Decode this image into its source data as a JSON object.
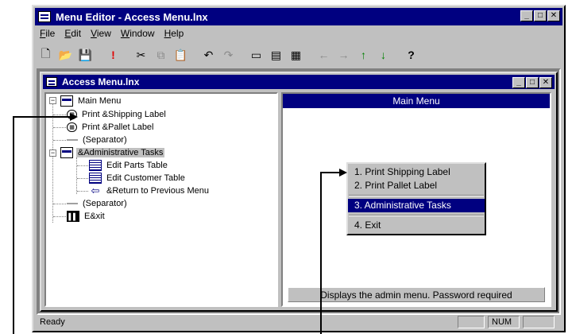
{
  "window": {
    "title": "Menu Editor - Access Menu.lnx",
    "controls": [
      "_",
      "□",
      "✕"
    ]
  },
  "menubar": [
    "File",
    "Edit",
    "View",
    "Window",
    "Help"
  ],
  "toolbar": {
    "buttons": [
      {
        "name": "new-icon",
        "glyph": "🗋"
      },
      {
        "name": "open-icon",
        "glyph": "📂"
      },
      {
        "name": "save-icon",
        "glyph": "💾"
      },
      {
        "name": "run-icon",
        "glyph": "!"
      },
      {
        "name": "cut-icon",
        "glyph": "✂"
      },
      {
        "name": "copy-icon",
        "glyph": "⧉"
      },
      {
        "name": "paste-icon",
        "glyph": "📋"
      },
      {
        "name": "undo-icon",
        "glyph": "↶"
      },
      {
        "name": "redo-icon",
        "glyph": "↷"
      },
      {
        "name": "insert-item-icon",
        "glyph": "▭"
      },
      {
        "name": "insert-submenu-icon",
        "glyph": "▤"
      },
      {
        "name": "properties-icon",
        "glyph": "▦"
      },
      {
        "name": "move-left-icon",
        "glyph": "←"
      },
      {
        "name": "move-right-icon",
        "glyph": "→"
      },
      {
        "name": "move-up-icon",
        "glyph": "↑"
      },
      {
        "name": "move-down-icon",
        "glyph": "↓"
      },
      {
        "name": "help-icon",
        "glyph": "?"
      }
    ]
  },
  "child": {
    "title": "Access Menu.lnx"
  },
  "tree": {
    "root": "Main Menu",
    "items": [
      {
        "label": "Print &Shipping Label",
        "icon": "print-icon"
      },
      {
        "label": "Print &Pallet Label",
        "icon": "print-icon"
      },
      {
        "label": "(Separator)",
        "icon": "separator-icon"
      },
      {
        "label": "&Administrative Tasks",
        "icon": "submenu-icon"
      },
      {
        "label": "Edit Parts Table",
        "icon": "table-icon"
      },
      {
        "label": "Edit Customer Table",
        "icon": "table-icon"
      },
      {
        "label": "&Return to Previous Menu",
        "icon": "return-icon"
      },
      {
        "label": "(Separator)",
        "icon": "separator-icon"
      },
      {
        "label": "E&xit",
        "icon": "exit-icon"
      }
    ]
  },
  "preview": {
    "title": "Main Menu",
    "menu": [
      "1. Print Shipping Label",
      "2. Print Pallet Label",
      "3. Administrative Tasks",
      "4. Exit"
    ],
    "status": "Displays the admin menu. Password required"
  },
  "statusbar": {
    "text": "Ready",
    "num": "NUM"
  }
}
